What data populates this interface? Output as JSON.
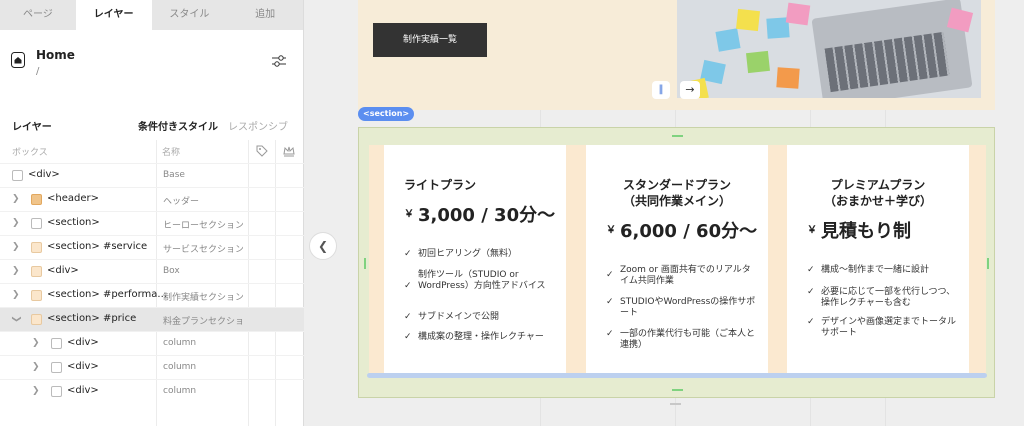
{
  "tabs": [
    "ページ",
    "レイヤー",
    "スタイル",
    "追加"
  ],
  "page": {
    "name": "Home",
    "path": "/"
  },
  "layers_panel": {
    "heading": "レイヤー",
    "conditional_style": "条件付きスタイル",
    "responsive": "レスポンシブ",
    "col_box": "ボックス",
    "col_name": "名称"
  },
  "rows": [
    {
      "label": "<div>",
      "name": "Base"
    },
    {
      "label": "<header>",
      "name": "ヘッダー"
    },
    {
      "label": "<section>",
      "name": "ヒーローセクション"
    },
    {
      "label": "<section> #service",
      "name": "サービスセクション"
    },
    {
      "label": "<div>",
      "name": "Box"
    },
    {
      "label": "<section> #performa...",
      "name": "制作実績セクション"
    },
    {
      "label": "<section> #price",
      "name": "料金プランセクショ"
    },
    {
      "label": "<div>",
      "name": "column"
    },
    {
      "label": "<div>",
      "name": "column"
    },
    {
      "label": "<div>",
      "name": "column"
    }
  ],
  "canvas": {
    "ruler": "1280px",
    "hero_button": "制作実績一覧",
    "section_tag": "<section>"
  },
  "plans": [
    {
      "title": "ライトプラン",
      "currency": "￥",
      "price": "3,000 / 30分〜",
      "features": [
        "初回ヒアリング（無料）",
        "制作ツール（STUDIO or WordPress）方向性アドバイス",
        "サブドメインで公開",
        "構成案の整理・操作レクチャー"
      ]
    },
    {
      "title": "スタンダードプラン\n（共同作業メイン）",
      "currency": "￥",
      "price": "6,000 / 60分〜",
      "features": [
        "Zoom or 画面共有でのリアルタイム共同作業",
        "STUDIOやWordPressの操作サポート",
        "一部の作業代行も可能（ご本人と連携）"
      ]
    },
    {
      "title": "プレミアムプラン\n（おまかせ＋学び）",
      "currency": "￥",
      "price": "見積もり制",
      "features": [
        "構成〜制作まで一緒に設計",
        "必要に応じて一部を代行しつつ、操作レクチャーも含む",
        "デザインや画像選定までトータルサポート"
      ]
    }
  ],
  "colors": {
    "hero_bg": "#f7ecd8",
    "section_bg": "#e6ecd0",
    "accent_blue": "#5b8ef0",
    "button_dark": "#333333"
  }
}
